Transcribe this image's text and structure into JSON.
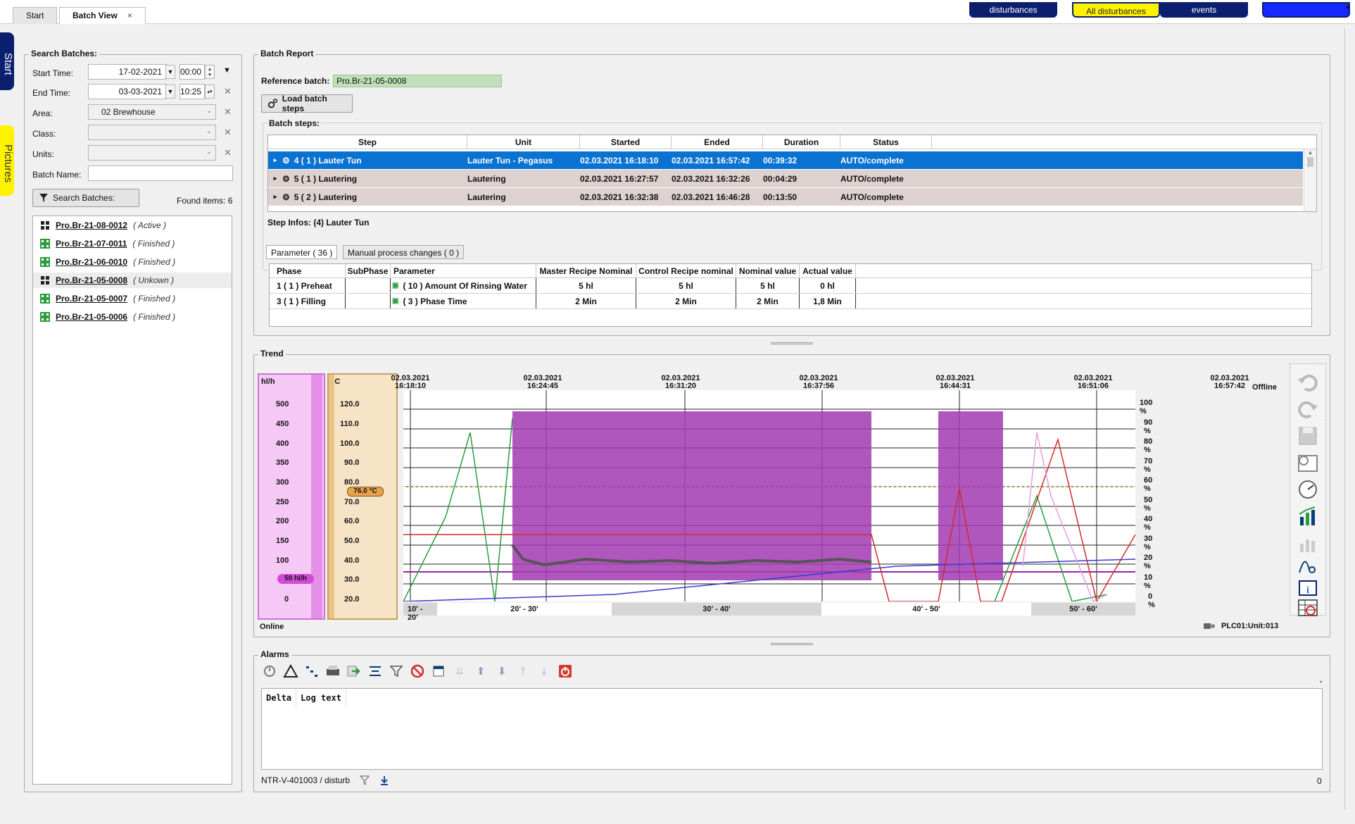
{
  "tabs": [
    {
      "label": "Start"
    },
    {
      "label": "Batch View"
    }
  ],
  "tab_close": "×",
  "function_tabs": [
    {
      "label": "disturbances"
    },
    {
      "label": "All disturbances"
    },
    {
      "label": "events"
    },
    {
      "label": ""
    }
  ],
  "side_tabs": {
    "start": "Start",
    "pictures": "Pictures"
  },
  "search": {
    "title": "Search Batches:",
    "start_time_label": "Start Time:",
    "start_date": "17-02-2021",
    "start_hour": "00:00",
    "end_time_label": "End Time:",
    "end_date": "03-03-2021",
    "end_hour": "10:25",
    "area_label": "Area:",
    "area_value": "02 Brewhouse",
    "class_label": "Class:",
    "class_value": "",
    "units_label": "Units:",
    "units_value": "",
    "batch_name_label": "Batch Name:",
    "batch_name_value": "",
    "search_button": "Search Batches:",
    "found_items": "Found items: 6",
    "batches": [
      {
        "name": "Pro.Br-21-08-0012",
        "status": "( Active )"
      },
      {
        "name": "Pro.Br-21-07-0011",
        "status": "( Finished )"
      },
      {
        "name": "Pro.Br-21-06-0010",
        "status": "( Finished )"
      },
      {
        "name": "Pro.Br-21-05-0008",
        "status": "( Unkown )"
      },
      {
        "name": "Pro.Br-21-05-0007",
        "status": "( Finished )"
      },
      {
        "name": "Pro.Br-21-05-0006",
        "status": "( Finished )"
      }
    ]
  },
  "report": {
    "title": "Batch Report",
    "reference_label": "Reference batch:",
    "reference_value": "Pro.Br-21-05-0008",
    "load_button": "Load batch steps",
    "steps_label": "Batch steps:",
    "columns": [
      "Step",
      "Unit",
      "Started",
      "Ended",
      "Duration",
      "Status"
    ],
    "rows": [
      {
        "step": "4 ( 1 )  Lauter Tun",
        "unit": "Lauter Tun - Pegasus",
        "started": "02.03.2021 16:18:10",
        "ended": "02.03.2021 16:57:42",
        "duration": "00:39:32",
        "status": "AUTO/complete"
      },
      {
        "step": "5 ( 1 )  Lautering",
        "unit": "Lautering",
        "started": "02.03.2021 16:27:57",
        "ended": "02.03.2021 16:32:26",
        "duration": "00:04:29",
        "status": "AUTO/complete"
      },
      {
        "step": "5 ( 2 )  Lautering",
        "unit": "Lautering",
        "started": "02.03.2021 16:32:38",
        "ended": "02.03.2021 16:46:28",
        "duration": "00:13:50",
        "status": "AUTO/complete"
      }
    ],
    "step_infos_label": "Step Infos:  (4) Lauter Tun",
    "subtabs": [
      "Parameter  ( 36 )",
      "Manual process changes  ( 0 )"
    ],
    "param_columns": [
      "Phase",
      "SubPhase",
      "Parameter",
      "Master Recipe Nominal",
      "Control Recipe nominal",
      "Nominal value",
      "Actual value"
    ],
    "param_rows": [
      {
        "phase": "1 ( 1 )  Preheat",
        "sub": "",
        "param": "( 10 )  Amount Of Rinsing Water",
        "master": "5 hl",
        "control": "5 hl",
        "nominal": "5 hl",
        "actual": "0 hl"
      },
      {
        "phase": "3 ( 1 )  Filling",
        "sub": "",
        "param": "( 3 )  Phase Time",
        "master": "2 Min",
        "control": "2 Min",
        "nominal": "2 Min",
        "actual": "1,8 Min"
      }
    ]
  },
  "trend": {
    "title": "Trend",
    "axis1_unit": "hl/h",
    "axis1_ticks": [
      "500",
      "450",
      "400",
      "350",
      "300",
      "250",
      "200",
      "150",
      "100",
      "50",
      "0"
    ],
    "axis1_marker": "50 hl/h",
    "axis2_unit": "°C",
    "axis2_ticks": [
      "120.0",
      "110.0",
      "100.0",
      "90.0",
      "80.0",
      "70.0",
      "60.0",
      "50.0",
      "40.0",
      "30.0",
      "20.0"
    ],
    "axis2_marker": "76.0 °C",
    "time_labels": [
      {
        "d": "02.03.2021",
        "t": "16:18:10"
      },
      {
        "d": "02.03.2021",
        "t": "16:24:45"
      },
      {
        "d": "02.03.2021",
        "t": "16:31:20"
      },
      {
        "d": "02.03.2021",
        "t": "16:37:56"
      },
      {
        "d": "02.03.2021",
        "t": "16:44:31"
      },
      {
        "d": "02.03.2021",
        "t": "16:51:06"
      },
      {
        "d": "02.03.2021",
        "t": "16:57:42"
      }
    ],
    "offline_label": "Offline",
    "pct_ticks": [
      "100 %",
      "90 %",
      "80 %",
      "70 %",
      "60 %",
      "50 %",
      "40 %",
      "30 %",
      "20 %",
      "10 %",
      "0 %"
    ],
    "segments": [
      "10' - 20'",
      "20' - 30'",
      "30' - 40'",
      "40' - 50'",
      "50' - 60'"
    ],
    "status_left": "Online",
    "status_right": "PLC01:Unit:013"
  },
  "alarms": {
    "title": "Alarms",
    "columns": [
      "Delta",
      "Log text"
    ],
    "footer_left": "NTR-V-401003 / disturb",
    "footer_right": "0"
  }
}
